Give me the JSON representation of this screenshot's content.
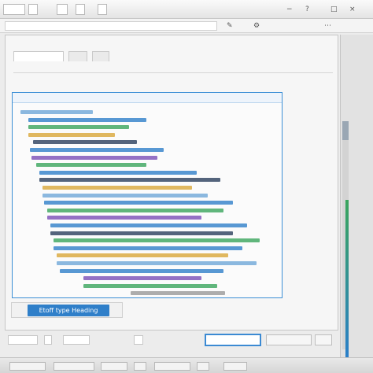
{
  "colors": {
    "accent": "#3b8ad3",
    "code_colors": [
      "#2f7fc9",
      "#3aa55d",
      "#d9a83a",
      "#7a4fb8",
      "#2a3e5c",
      "#6fa8d8",
      "#9a9a9a"
    ]
  },
  "main": {
    "style_label": "Etoff type Heading"
  },
  "code_lines": [
    {
      "indent": 10,
      "width": 92,
      "color": 5
    },
    {
      "indent": 20,
      "width": 150,
      "color": 0
    },
    {
      "indent": 20,
      "width": 128,
      "color": 1
    },
    {
      "indent": 20,
      "width": 110,
      "color": 2
    },
    {
      "indent": 26,
      "width": 132,
      "color": 4
    },
    {
      "indent": 22,
      "width": 170,
      "color": 0
    },
    {
      "indent": 24,
      "width": 160,
      "color": 3
    },
    {
      "indent": 30,
      "width": 140,
      "color": 1
    },
    {
      "indent": 34,
      "width": 200,
      "color": 0
    },
    {
      "indent": 34,
      "width": 230,
      "color": 4
    },
    {
      "indent": 38,
      "width": 190,
      "color": 2
    },
    {
      "indent": 38,
      "width": 210,
      "color": 5
    },
    {
      "indent": 40,
      "width": 240,
      "color": 0
    },
    {
      "indent": 44,
      "width": 224,
      "color": 1
    },
    {
      "indent": 44,
      "width": 196,
      "color": 3
    },
    {
      "indent": 48,
      "width": 250,
      "color": 0
    },
    {
      "indent": 48,
      "width": 232,
      "color": 4
    },
    {
      "indent": 52,
      "width": 262,
      "color": 1
    },
    {
      "indent": 52,
      "width": 240,
      "color": 0
    },
    {
      "indent": 56,
      "width": 218,
      "color": 2
    },
    {
      "indent": 56,
      "width": 254,
      "color": 5
    },
    {
      "indent": 60,
      "width": 208,
      "color": 0
    },
    {
      "indent": 90,
      "width": 150,
      "color": 3
    },
    {
      "indent": 90,
      "width": 170,
      "color": 1
    },
    {
      "indent": 150,
      "width": 120,
      "color": 6
    }
  ]
}
